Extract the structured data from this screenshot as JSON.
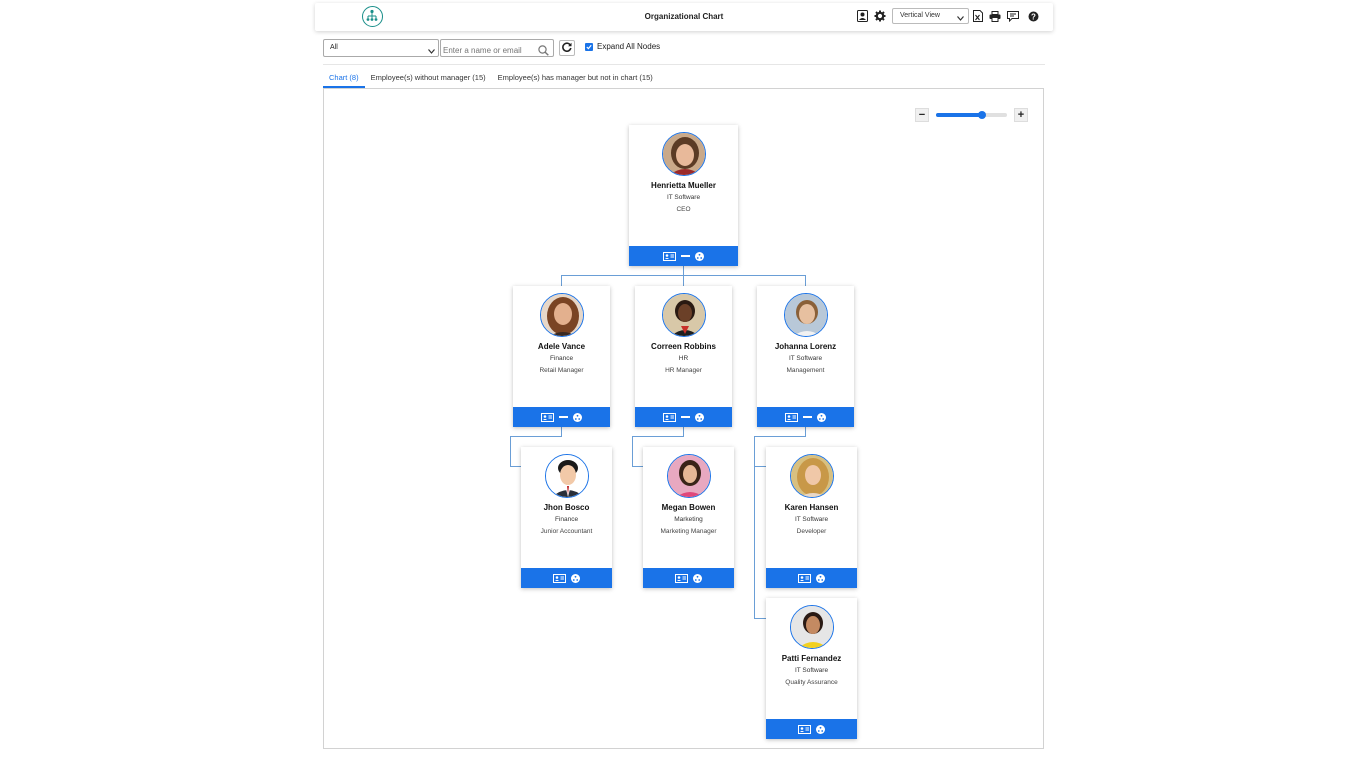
{
  "header": {
    "title": "Organizational Chart",
    "view_select": "Vertical View"
  },
  "toolbar": {
    "filter_value": "All",
    "search_placeholder": "Enter a name or email",
    "expand_label": "Expand All Nodes",
    "expand_checked": true
  },
  "tabs": [
    {
      "label": "Chart (8)",
      "active": true
    },
    {
      "label": "Employee(s) without manager (15)",
      "active": false
    },
    {
      "label": "Employee(s) has manager but not in chart (15)",
      "active": false
    }
  ],
  "zoom": {
    "level": 0.65
  },
  "colors": {
    "accent": "#1a73e8",
    "connector": "#6a9ed6",
    "logo": "#1a8f8a"
  },
  "employees": [
    {
      "name": "Henrietta Mueller",
      "department": "IT Software",
      "title": "CEO"
    },
    {
      "name": "Adele Vance",
      "department": "Finance",
      "title": "Retail Manager"
    },
    {
      "name": "Correen Robbins",
      "department": "HR",
      "title": "HR Manager"
    },
    {
      "name": "Johanna Lorenz",
      "department": "IT Software",
      "title": "Management"
    },
    {
      "name": "Jhon Bosco",
      "department": "Finance",
      "title": "Junior Accountant"
    },
    {
      "name": "Megan Bowen",
      "department": "Marketing",
      "title": "Marketing Manager"
    },
    {
      "name": "Karen Hansen",
      "department": "IT Software",
      "title": "Developer"
    },
    {
      "name": "Patti Fernandez",
      "department": "IT Software",
      "title": "Quality Assurance"
    }
  ]
}
